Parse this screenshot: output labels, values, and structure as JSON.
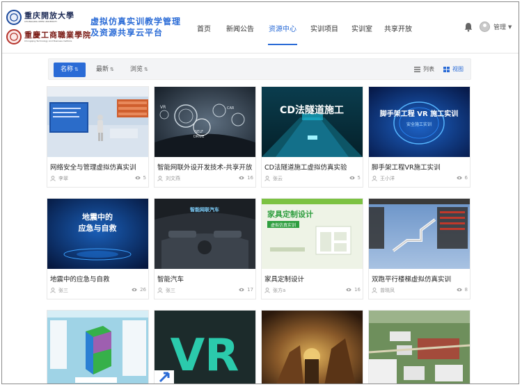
{
  "header": {
    "logo_university": "重庆開放大學",
    "logo_university_en": "CHONGQING OPEN UNIVERSITY",
    "logo_college": "重慶工商職業學院",
    "logo_college_en": "Chongqing Technology And Business Institute",
    "platform_title_line1": "虚拟仿真实训教学管理",
    "platform_title_line2": "及资源共享云平台",
    "nav": [
      {
        "label": "首页",
        "active": false
      },
      {
        "label": "新闻公告",
        "active": false
      },
      {
        "label": "资源中心",
        "active": true
      },
      {
        "label": "实训项目",
        "active": false
      },
      {
        "label": "实训室",
        "active": false
      },
      {
        "label": "共享开放",
        "active": false
      }
    ],
    "user_name": "管理",
    "bell_icon": "bell-icon",
    "caret_icon": "caret-down-icon"
  },
  "toolbar": {
    "sort_name": "名称",
    "sort_latest": "最新",
    "sort_views": "浏览",
    "view_list": "列表",
    "view_grid": "视图",
    "accent": "#2a6bd6"
  },
  "cards": [
    {
      "title": "网络安全与管理虚拟仿真实训",
      "author": "李翠",
      "views": "5"
    },
    {
      "title": "智能网联外设开发技术-共享开放",
      "author": "刘文燕",
      "views": "16"
    },
    {
      "title": "CD法隧道施工虚拟仿真实验",
      "author": "张云",
      "views": "5"
    },
    {
      "title": "脚手架工程VR施工实训",
      "author": "王小洋",
      "views": "6"
    },
    {
      "title": "地震中的应急与自救",
      "author": "张三",
      "views": "26"
    },
    {
      "title": "智能汽车",
      "author": "张三",
      "views": "17"
    },
    {
      "title": "家具定制设计",
      "author": "张方a",
      "views": "16"
    },
    {
      "title": "双跑平行楼梯虚拟仿真实训",
      "author": "曾晓凤",
      "views": "8"
    },
    {
      "title": "",
      "author": "",
      "views": ""
    },
    {
      "title": "",
      "author": "",
      "views": ""
    },
    {
      "title": "",
      "author": "",
      "views": ""
    },
    {
      "title": "",
      "author": "",
      "views": ""
    }
  ],
  "thumbnails": {
    "t3": "CD法隧道施工",
    "t4_line1": "脚手架工程 VR 施工实训",
    "t4_line2": "安全施工实训",
    "t5_line1": "地震中的",
    "t5_line2": "应急与自救",
    "t6": "智能网联汽车",
    "t7_line1": "家具定制设计",
    "t7_line2": "虚拟仿真实训",
    "t10": "VR",
    "t2_labels": [
      "SELF",
      "DRIVE",
      "CAR",
      "VR"
    ]
  }
}
